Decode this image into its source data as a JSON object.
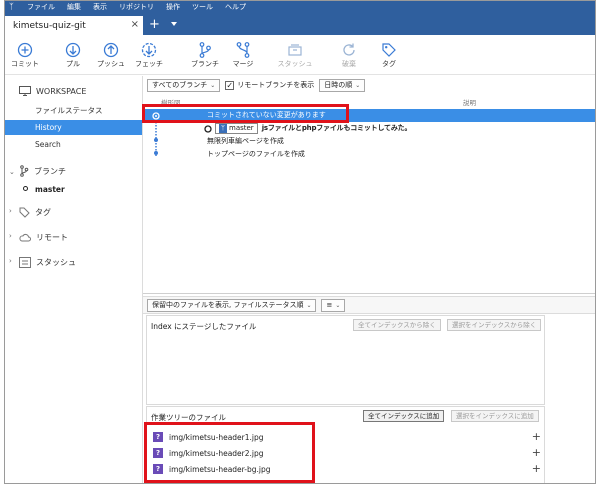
{
  "menu": [
    "ファイル",
    "編集",
    "表示",
    "リポジトリ",
    "操作",
    "ツール",
    "ヘルプ"
  ],
  "tab": {
    "title": "kimetsu-quiz-git",
    "close": "×",
    "add": "+"
  },
  "toolbar": {
    "commit": "コミット",
    "pull": "プル",
    "push": "プッシュ",
    "fetch": "フェッチ",
    "branch": "ブランチ",
    "merge": "マージ",
    "stash": "スタッシュ",
    "discard": "破棄",
    "tag": "タグ"
  },
  "sidebar": {
    "workspace": "WORKSPACE",
    "file_status": "ファイルステータス",
    "history": "History",
    "search": "Search",
    "branches": "ブランチ",
    "master": "master",
    "tags": "タグ",
    "remotes": "リモート",
    "stash": "スタッシュ"
  },
  "filters": {
    "branches": "すべてのブランチ",
    "show_remote": "リモートブランチを表示",
    "order": "日時の順"
  },
  "columns": {
    "graph": "樹形図",
    "description": "説明"
  },
  "commits": [
    {
      "text": "コミットされていない変更があります"
    },
    {
      "branch": "master",
      "text": "jsファイルとphpファイルもコミットしてみた。"
    },
    {
      "text": "無限列車編ページを作成"
    },
    {
      "text": "トップページのファイルを作成"
    }
  ],
  "midbar": {
    "view": "保留中のファイルを表示, ファイルステータス順",
    "list": "≡"
  },
  "staged": {
    "title": "Index にステージしたファイル",
    "unstage_all": "全てインデックスから除く",
    "unstage_sel": "選択をインデックスから除く"
  },
  "working": {
    "title": "作業ツリーのファイル",
    "stage_all": "全てインデックスに追加",
    "stage_sel": "選択をインデックスに追加",
    "files": [
      "img/kimetsu-header1.jpg",
      "img/kimetsu-header2.jpg",
      "img/kimetsu-header-bg.jpg"
    ]
  },
  "colors": {
    "accent": "#3a8ee6",
    "titlebar": "#2f5f9e",
    "highlight": "#e0121a",
    "file_icon": "#6a4bb7"
  }
}
